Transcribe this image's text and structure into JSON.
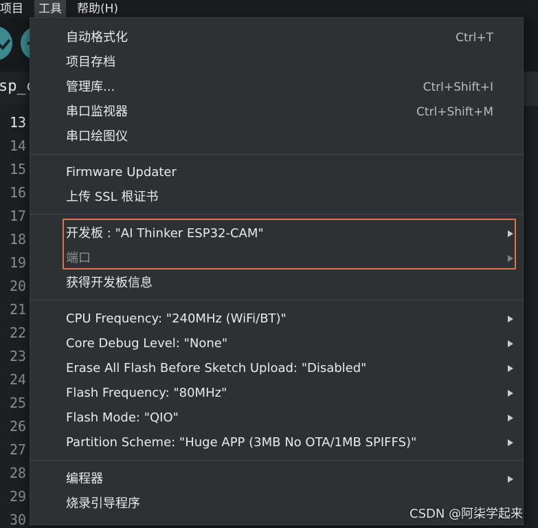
{
  "menubar": {
    "items": [
      {
        "label": "项目"
      },
      {
        "label": "工具"
      },
      {
        "label": "帮助(H)"
      }
    ]
  },
  "editor": {
    "tab_label": "sp_c",
    "line_numbers": [
      "13",
      "14",
      "15",
      "16",
      "17",
      "18",
      "19",
      "20",
      "21",
      "22",
      "23",
      "24",
      "25",
      "26",
      "27",
      "28",
      "29",
      "30"
    ],
    "current_line": "13"
  },
  "menu": {
    "group1": [
      {
        "label": "自动格式化",
        "shortcut": "Ctrl+T"
      },
      {
        "label": "项目存档",
        "shortcut": ""
      },
      {
        "label": "管理库...",
        "shortcut": "Ctrl+Shift+I"
      },
      {
        "label": "串口监视器",
        "shortcut": "Ctrl+Shift+M"
      },
      {
        "label": "串口绘图仪",
        "shortcut": ""
      }
    ],
    "group2": [
      {
        "label": "Firmware Updater"
      },
      {
        "label": "上传 SSL 根证书"
      }
    ],
    "group3": [
      {
        "label": "开发板 : \"AI Thinker ESP32-CAM\"",
        "submenu": true,
        "disabled": false
      },
      {
        "label": "端口",
        "submenu": true,
        "disabled": true
      },
      {
        "label": "获得开发板信息",
        "submenu": false,
        "disabled": false
      }
    ],
    "group4": [
      {
        "label": "CPU Frequency: \"240MHz (WiFi/BT)\""
      },
      {
        "label": "Core Debug Level: \"None\""
      },
      {
        "label": "Erase All Flash Before Sketch Upload: \"Disabled\""
      },
      {
        "label": "Flash Frequency: \"80MHz\""
      },
      {
        "label": "Flash Mode: \"QIO\""
      },
      {
        "label": "Partition Scheme: \"Huge APP (3MB No OTA/1MB SPIFFS)\""
      }
    ],
    "group5": [
      {
        "label": "编程器",
        "submenu": true
      },
      {
        "label": "烧录引导程序",
        "submenu": false
      }
    ]
  },
  "watermark": "CSDN @阿柒学起来",
  "colors": {
    "menu_bg": "#2d3134",
    "highlight_border": "#d9784f",
    "toolbar_button": "#3c8a8f"
  }
}
